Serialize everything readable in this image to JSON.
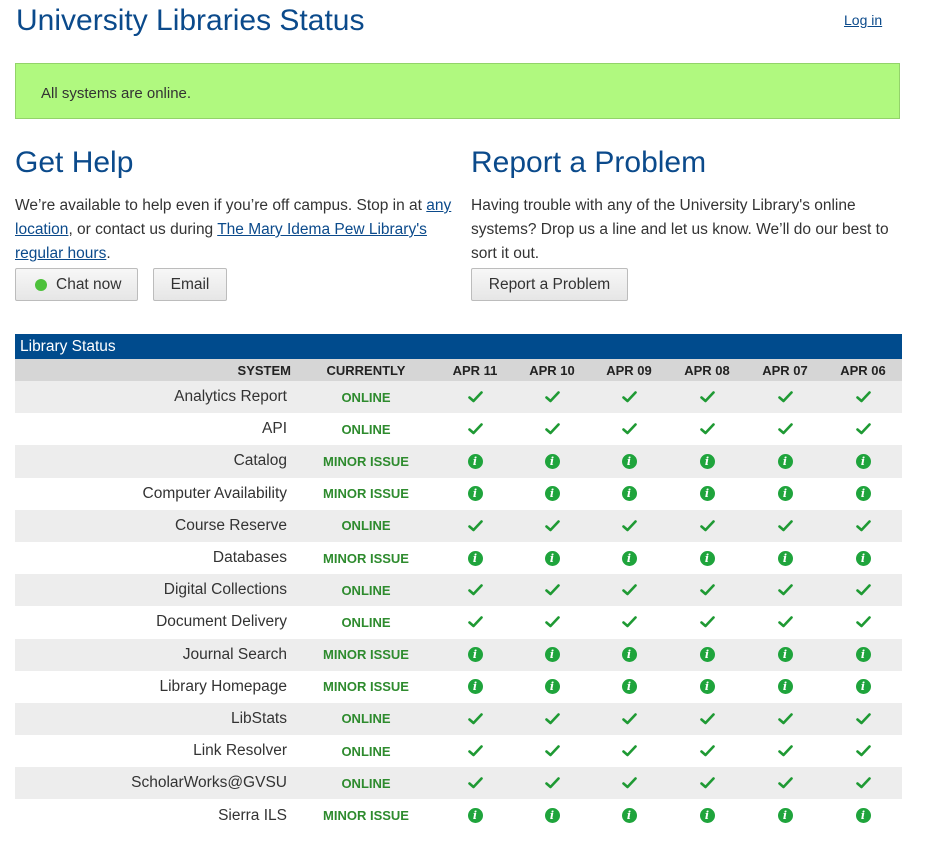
{
  "header": {
    "title": "University Libraries Status",
    "login_label": "Log in"
  },
  "banner": {
    "text": "All systems are online.",
    "color": "#b0f97f"
  },
  "help": {
    "heading": "Get Help",
    "text_1": "We’re available to help even if you’re off campus. Stop in at ",
    "link_1": "any location",
    "text_2": ", or contact us during ",
    "link_2": "The Mary Idema Pew Library's regular hours",
    "text_3": ".",
    "chat_label": "Chat now",
    "email_label": "Email"
  },
  "report": {
    "heading": "Report a Problem",
    "text": "Having trouble with any of the University Library's online systems? Drop us a line and let us know. We’ll do our best to sort it out.",
    "button_label": "Report a Problem"
  },
  "table": {
    "title": "Library Status",
    "col_system": "SYSTEM",
    "col_currently": "CURRENTLY",
    "days": [
      "APR 11",
      "APR 10",
      "APR 09",
      "APR 08",
      "APR 07",
      "APR 06"
    ],
    "status_colors": {
      "online": "#2e8b2e",
      "icon": "#1fa43c",
      "header_bg": "#004b8d"
    },
    "rows": [
      {
        "system": "Analytics Report",
        "currently": "ONLINE",
        "days": [
          "check-icon",
          "check-icon",
          "check-icon",
          "check-icon",
          "check-icon",
          "check-icon"
        ]
      },
      {
        "system": "API",
        "currently": "ONLINE",
        "days": [
          "check-icon",
          "check-icon",
          "check-icon",
          "check-icon",
          "check-icon",
          "check-icon"
        ]
      },
      {
        "system": "Catalog",
        "currently": "MINOR ISSUE",
        "days": [
          "info-icon",
          "info-icon",
          "info-icon",
          "info-icon",
          "info-icon",
          "info-icon"
        ]
      },
      {
        "system": "Computer Availability",
        "currently": "MINOR ISSUE",
        "days": [
          "info-icon",
          "info-icon",
          "info-icon",
          "info-icon",
          "info-icon",
          "info-icon"
        ]
      },
      {
        "system": "Course Reserve",
        "currently": "ONLINE",
        "days": [
          "check-icon",
          "check-icon",
          "check-icon",
          "check-icon",
          "check-icon",
          "check-icon"
        ]
      },
      {
        "system": "Databases",
        "currently": "MINOR ISSUE",
        "days": [
          "info-icon",
          "info-icon",
          "info-icon",
          "info-icon",
          "info-icon",
          "info-icon"
        ]
      },
      {
        "system": "Digital Collections",
        "currently": "ONLINE",
        "days": [
          "check-icon",
          "check-icon",
          "check-icon",
          "check-icon",
          "check-icon",
          "check-icon"
        ]
      },
      {
        "system": "Document Delivery",
        "currently": "ONLINE",
        "days": [
          "check-icon",
          "check-icon",
          "check-icon",
          "check-icon",
          "check-icon",
          "check-icon"
        ]
      },
      {
        "system": "Journal Search",
        "currently": "MINOR ISSUE",
        "days": [
          "info-icon",
          "info-icon",
          "info-icon",
          "info-icon",
          "info-icon",
          "info-icon"
        ]
      },
      {
        "system": "Library Homepage",
        "currently": "MINOR ISSUE",
        "days": [
          "info-icon",
          "info-icon",
          "info-icon",
          "info-icon",
          "info-icon",
          "info-icon"
        ]
      },
      {
        "system": "LibStats",
        "currently": "ONLINE",
        "days": [
          "check-icon",
          "check-icon",
          "check-icon",
          "check-icon",
          "check-icon",
          "check-icon"
        ]
      },
      {
        "system": "Link Resolver",
        "currently": "ONLINE",
        "days": [
          "check-icon",
          "check-icon",
          "check-icon",
          "check-icon",
          "check-icon",
          "check-icon"
        ]
      },
      {
        "system": "ScholarWorks@GVSU",
        "currently": "ONLINE",
        "days": [
          "check-icon",
          "check-icon",
          "check-icon",
          "check-icon",
          "check-icon",
          "check-icon"
        ]
      },
      {
        "system": "Sierra ILS",
        "currently": "MINOR ISSUE",
        "days": [
          "info-icon",
          "info-icon",
          "info-icon",
          "info-icon",
          "info-icon",
          "info-icon"
        ]
      }
    ]
  }
}
